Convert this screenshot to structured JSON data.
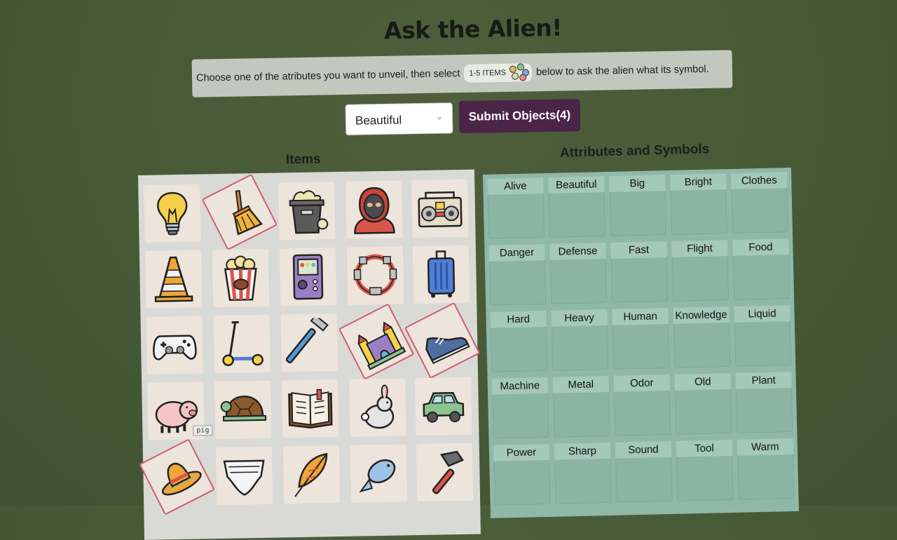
{
  "title": "Ask the Alien!",
  "instructions": {
    "before": "Choose one of the atributes you want to unveil, then select",
    "pill": "1-5 ITEMS",
    "after": "below to ask the alien what its symbol."
  },
  "controls": {
    "selected_attribute": "Beautiful",
    "submit_label": "Submit Objects(4)"
  },
  "items_label": "Items",
  "attributes_label": "Attributes and Symbols",
  "tooltip": "pig",
  "items": [
    {
      "name": "lightbulb",
      "selected": false
    },
    {
      "name": "broom",
      "selected": true
    },
    {
      "name": "trash-can",
      "selected": false
    },
    {
      "name": "hooded-person",
      "selected": false
    },
    {
      "name": "boombox",
      "selected": false
    },
    {
      "name": "traffic-cone",
      "selected": false
    },
    {
      "name": "popcorn",
      "selected": false
    },
    {
      "name": "handheld-game",
      "selected": false
    },
    {
      "name": "tambourine",
      "selected": false
    },
    {
      "name": "suitcase",
      "selected": false
    },
    {
      "name": "game-controller",
      "selected": false
    },
    {
      "name": "scooter",
      "selected": false
    },
    {
      "name": "razor",
      "selected": false
    },
    {
      "name": "bounce-castle",
      "selected": true
    },
    {
      "name": "sneaker",
      "selected": true
    },
    {
      "name": "pig",
      "selected": false
    },
    {
      "name": "turtle",
      "selected": false
    },
    {
      "name": "book",
      "selected": false
    },
    {
      "name": "rabbit",
      "selected": false
    },
    {
      "name": "car",
      "selected": false
    },
    {
      "name": "sombrero",
      "selected": true
    },
    {
      "name": "diaper",
      "selected": false
    },
    {
      "name": "feather",
      "selected": false
    },
    {
      "name": "fish",
      "selected": false
    },
    {
      "name": "hammer",
      "selected": false
    }
  ],
  "attributes": [
    "Alive",
    "Beautiful",
    "Big",
    "Bright",
    "Clothes",
    "Danger",
    "Defense",
    "Fast",
    "Flight",
    "Food",
    "Hard",
    "Heavy",
    "Human",
    "Knowledge",
    "Liquid",
    "Machine",
    "Metal",
    "Odor",
    "Old",
    "Plant",
    "Power",
    "Sharp",
    "Sound",
    "Tool",
    "Warm"
  ],
  "colors": {
    "selection_border": "#d15e6e",
    "submit_bg": "#4a2548",
    "attr_panel": "#90b8a8"
  }
}
